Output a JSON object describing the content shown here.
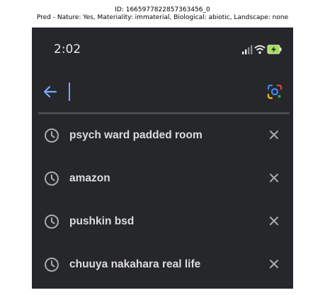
{
  "caption": {
    "line1": "ID: 1665977822857363456_0",
    "line2": "Pred - Nature: Yes, Materiality: immaterial, Biological: abiotic, Landscape: none"
  },
  "status_bar": {
    "time": "2:02",
    "icons": [
      "signal-icon",
      "wifi-icon",
      "battery-charging-icon"
    ]
  },
  "search": {
    "value": "",
    "back_icon": "arrow-left-icon",
    "lens_icon": "google-lens-icon"
  },
  "history": [
    {
      "query": "psych ward padded room",
      "icon": "history-clock-icon",
      "action_icon": "close-icon"
    },
    {
      "query": "amazon",
      "icon": "history-clock-icon",
      "action_icon": "close-icon"
    },
    {
      "query": "pushkin bsd",
      "icon": "history-clock-icon",
      "action_icon": "close-icon"
    },
    {
      "query": "chuuya nakahara real life",
      "icon": "history-clock-icon",
      "action_icon": "close-icon"
    }
  ],
  "colors": {
    "background": "#26272b",
    "text": "#dcdcdc",
    "accent_blue": "#7aa7ff",
    "icon_gray": "#a9aaae"
  }
}
